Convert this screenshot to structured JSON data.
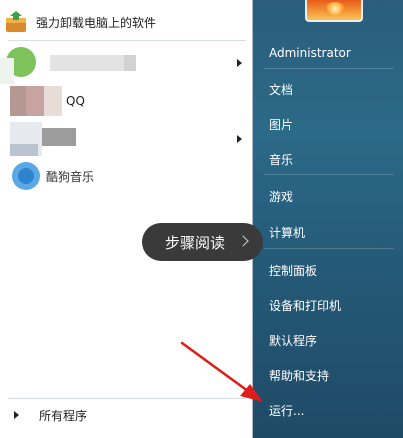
{
  "left_pane": {
    "items": [
      {
        "label": "强力卸载电脑上的软件",
        "icon": "uninstall-box-icon"
      },
      {
        "label": "",
        "icon": "blurred-app-icon",
        "has_submenu": true
      },
      {
        "label": "QQ",
        "icon": "qq-icon"
      },
      {
        "label": "",
        "icon": "blurred-app-icon",
        "has_submenu": true
      },
      {
        "label": "酷狗音乐",
        "icon": "kugou-music-icon"
      }
    ],
    "all_programs_label": "所有程序"
  },
  "right_pane": {
    "user_picture": "flower-user-picture",
    "items": [
      "Administrator",
      "文档",
      "图片",
      "音乐",
      "游戏",
      "计算机",
      "控制面板",
      "设备和打印机",
      "默认程序",
      "帮助和支持",
      "运行..."
    ]
  },
  "overlay": {
    "steps_button_label": "步骤阅读",
    "arrow_color": "#e01b1b"
  },
  "colors": {
    "right_pane_bg": "#2b6a88",
    "overlay_bg": "#3a3a3a"
  }
}
